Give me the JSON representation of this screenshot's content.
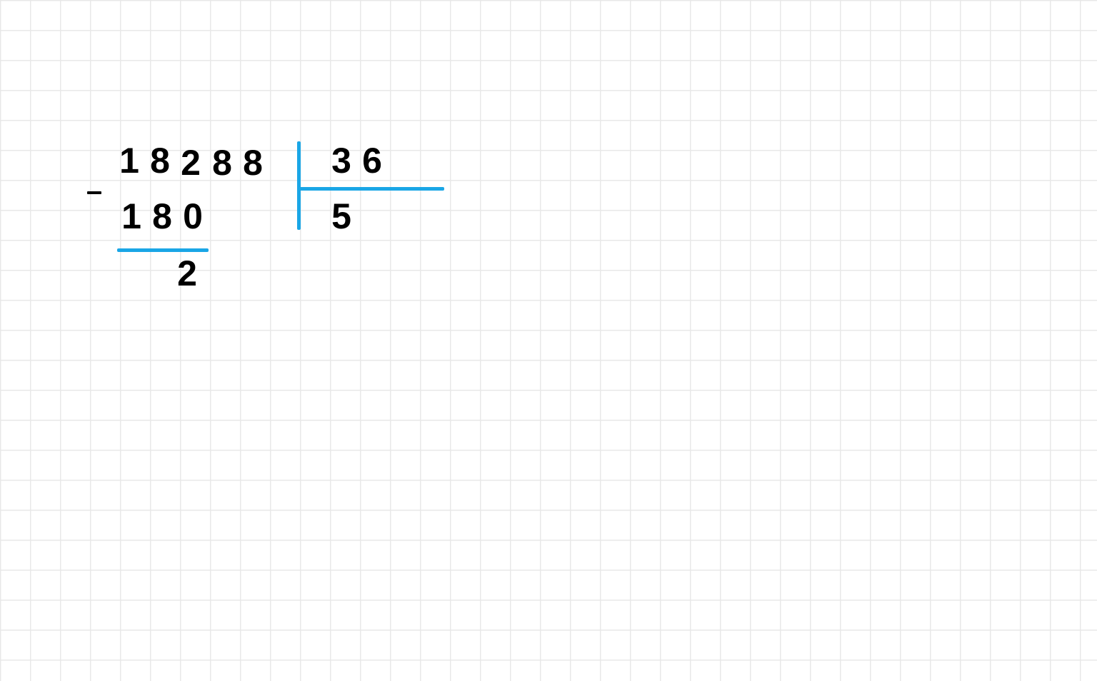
{
  "colors": {
    "stroke": "#1aa6e6",
    "ink": "#000000",
    "gridline": "#e8e8e8"
  },
  "grid_size_px": 42,
  "division": {
    "dividend": "18288",
    "divisor": "36",
    "quotient_so_far": "5",
    "subtrahend": "180",
    "remainder_so_far": "2",
    "minus_sign": "−"
  },
  "layout_comment": "European long-division layout: dividend on the left, a vertical bar, divisor top-right, horizontal bar under divisor, quotient below it. Subtraction steps written under the dividend."
}
